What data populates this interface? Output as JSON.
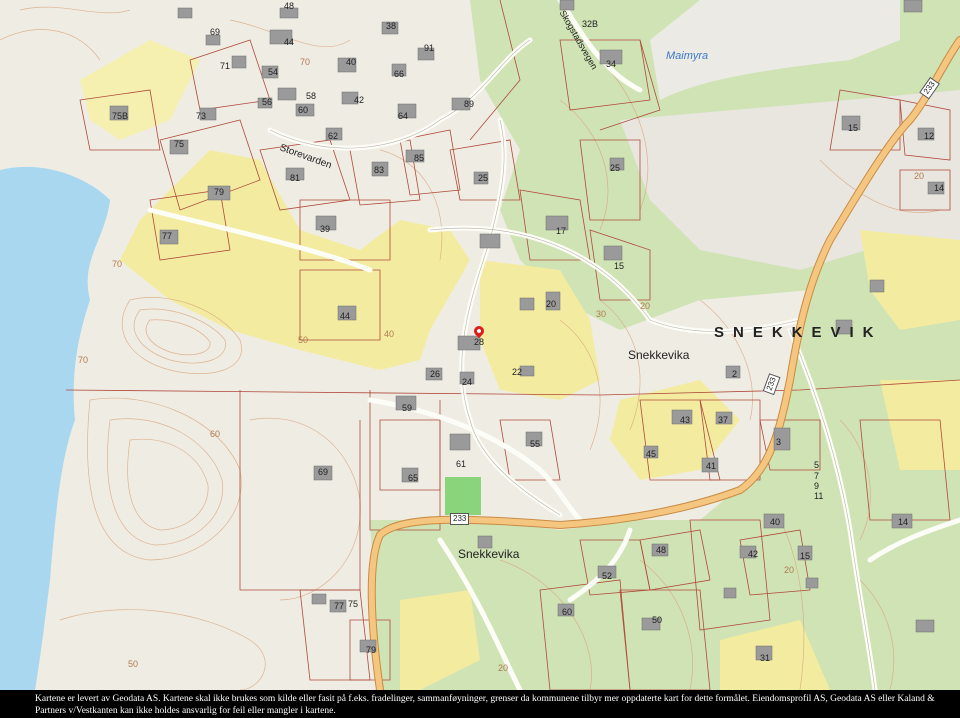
{
  "map": {
    "region_name": "SNEKKEVIK",
    "place_names": [
      "Snekkevika",
      "Snekkevika"
    ],
    "water_name": "Maimyra",
    "road_names": [
      "Storevarden",
      "Skogstadsvegen"
    ],
    "road_numbers": [
      "233",
      "233",
      "233"
    ],
    "contour_labels": [
      "70",
      "70",
      "40",
      "50",
      "60",
      "70",
      "30",
      "20",
      "20",
      "20",
      "20",
      "50"
    ],
    "house_numbers": [
      "48",
      "69",
      "44",
      "38",
      "91",
      "71",
      "54",
      "40",
      "66",
      "75B",
      "73",
      "58",
      "56",
      "60",
      "42",
      "64",
      "89",
      "62",
      "75",
      "85",
      "81",
      "83",
      "25",
      "79",
      "77",
      "39",
      "17",
      "44",
      "20",
      "15",
      "28",
      "26",
      "24",
      "22",
      "59",
      "55",
      "69",
      "61",
      "65",
      "43",
      "37",
      "45",
      "41",
      "3",
      "5",
      "7",
      "9",
      "11",
      "48",
      "40",
      "14",
      "42",
      "15",
      "52",
      "77",
      "75",
      "60",
      "50",
      "79",
      "31",
      "32B",
      "34",
      "15",
      "12",
      "14",
      "25",
      "2"
    ],
    "selected_property": "28",
    "colors": {
      "background": "#efece4",
      "forest": "#cfe3b5",
      "open_land": "#f3eca0",
      "water": "#a8d7ef",
      "field": "#8ad57c",
      "main_road": "#f5c67f",
      "property_line": "#b04a3a",
      "contour": "#d8a57c",
      "building": "#9a9a9a",
      "marker": "#e01b1b"
    }
  },
  "footer": {
    "disclaimer": "Kartene er levert av Geodata AS. Kartene skal ikke brukes som kilde eller fasit på f.eks. fradelinger, sammanføyninger, grenser da kommunene tilbyr mer oppdaterte kart for dette formålet. Eiendomsprofil AS, Geodata AS eller Kaland & Partners v/Vestkanten kan ikke holdes ansvarlig for feil eller mangler i kartene."
  }
}
